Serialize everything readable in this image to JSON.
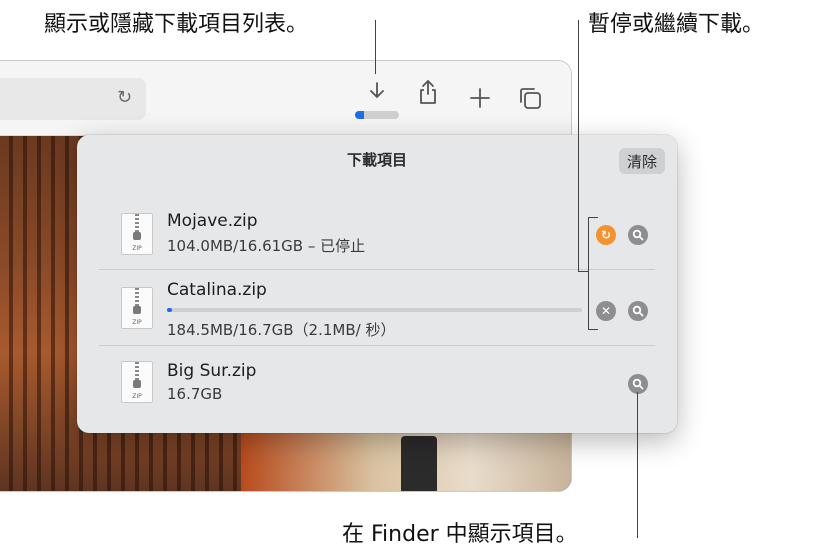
{
  "callouts": {
    "show_hide_list": "顯示或隱藏下載項目列表。",
    "pause_resume": "暫停或繼續下載。",
    "show_in_finder": "在 Finder 中顯示項目。"
  },
  "toolbar": {
    "reload_icon": "reload-icon",
    "download_icon": "download-arrow-icon",
    "share_icon": "share-icon",
    "new_tab_icon": "plus-icon",
    "tab_overview_icon": "tab-overview-icon",
    "download_progress": 0.2,
    "accent": "#1d6fe3"
  },
  "downloads": {
    "title": "下載項目",
    "clear_label": "清除",
    "items": [
      {
        "name": "Mojave.zip",
        "detail": "104.0MB/16.61GB – 已停止",
        "icon_label": "ZIP",
        "state": "stopped",
        "action": "resume"
      },
      {
        "name": "Catalina.zip",
        "detail": "184.5MB/16.7GB（2.1MB/ 秒）",
        "icon_label": "ZIP",
        "state": "downloading",
        "progress": 0.011,
        "action": "cancel"
      },
      {
        "name": "Big Sur.zip",
        "detail": "16.7GB",
        "icon_label": "ZIP",
        "state": "done"
      }
    ]
  },
  "colors": {
    "resume": "#f5922f",
    "action_gray": "#8d8d92",
    "popover_bg": "#e6e7e9"
  }
}
